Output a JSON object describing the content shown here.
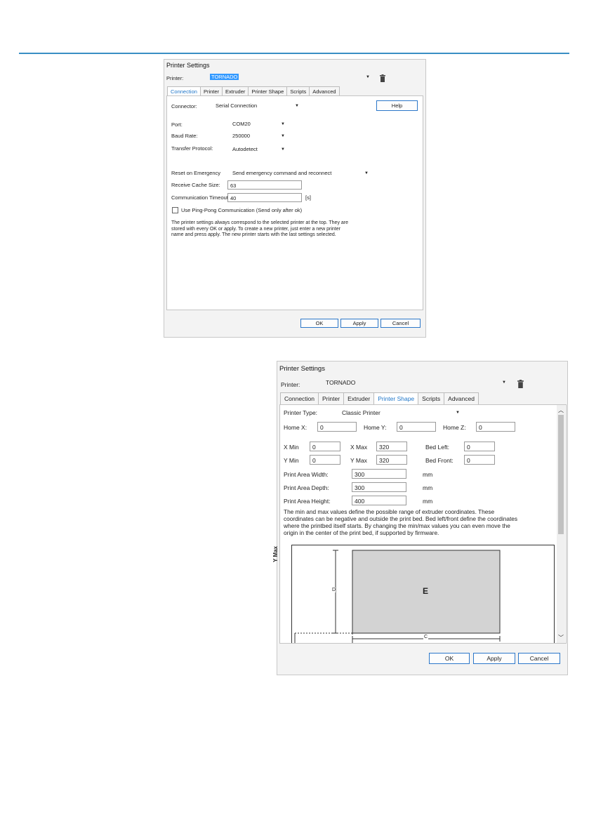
{
  "dialog1": {
    "title": "Printer Settings",
    "printer_label": "Printer:",
    "printer_value": "TORNADO",
    "tabs": [
      "Connection",
      "Printer",
      "Extruder",
      "Printer Shape",
      "Scripts",
      "Advanced"
    ],
    "active_tab": "Connection",
    "connector_label": "Connector:",
    "connector_value": "Serial Connection",
    "help_label": "Help",
    "port_label": "Port:",
    "port_value": "COM20",
    "baud_label": "Baud Rate:",
    "baud_value": "250000",
    "protocol_label": "Transfer Protocol:",
    "protocol_value": "Autodetect",
    "reset_label": "Reset on Emergency",
    "reset_value": "Send emergency command and reconnect",
    "cache_label": "Receive Cache Size:",
    "cache_value": "63",
    "timeout_label": "Communication Timeout:",
    "timeout_value": "40",
    "timeout_unit": "[s]",
    "pingpong_label": "Use Ping-Pong Communication (Send only after ok)",
    "note": "The printer settings always correspond to the selected printer at the top. They are stored with every OK or apply. To create a new printer, just enter a new printer name and press apply. The new printer starts with the last settings selected.",
    "ok_label": "OK",
    "apply_label": "Apply",
    "cancel_label": "Cancel"
  },
  "dialog2": {
    "title": "Printer Settings",
    "printer_label": "Printer:",
    "printer_value": "TORNADO",
    "tabs": [
      "Connection",
      "Printer",
      "Extruder",
      "Printer Shape",
      "Scripts",
      "Advanced"
    ],
    "active_tab": "Printer Shape",
    "printer_type_label": "Printer Type:",
    "printer_type_value": "Classic Printer",
    "home_x_label": "Home X:",
    "home_x_value": "0",
    "home_y_label": "Home Y:",
    "home_y_value": "0",
    "home_z_label": "Home Z:",
    "home_z_value": "0",
    "x_min_label": "X Min",
    "x_min_value": "0",
    "x_max_label": "X Max",
    "x_max_value": "320",
    "bed_left_label": "Bed Left:",
    "bed_left_value": "0",
    "y_min_label": "Y Min",
    "y_min_value": "0",
    "y_max_label": "Y Max",
    "y_max_value": "320",
    "bed_front_label": "Bed Front:",
    "bed_front_value": "0",
    "width_label": "Print Area Width:",
    "width_value": "300",
    "depth_label": "Print Area Depth:",
    "depth_value": "300",
    "height_label": "Print Area Height:",
    "height_value": "400",
    "unit_mm": "mm",
    "note": "The min and max values define the possible range of extruder coordinates. These coordinates can be negative and outside the print bed. Bed left/front define the coordinates where the printbed itself starts. By changing the min/max values you can even move the origin in the center of the print bed, if supported by firmware.",
    "diagram_y_axis_label": "Y Max",
    "diagram_bed_label": "E",
    "diagram_depth_label": "D",
    "diagram_width_label": "C",
    "ok_label": "OK",
    "apply_label": "Apply",
    "cancel_label": "Cancel"
  },
  "colors": {
    "accent": "#3a8fc4",
    "tab_active": "#1f76c9",
    "selection": "#3399ff",
    "bed_fill": "#d3d3d3"
  },
  "icons": {
    "delete": "trash-icon",
    "dropdown": "chevron-down-icon"
  }
}
